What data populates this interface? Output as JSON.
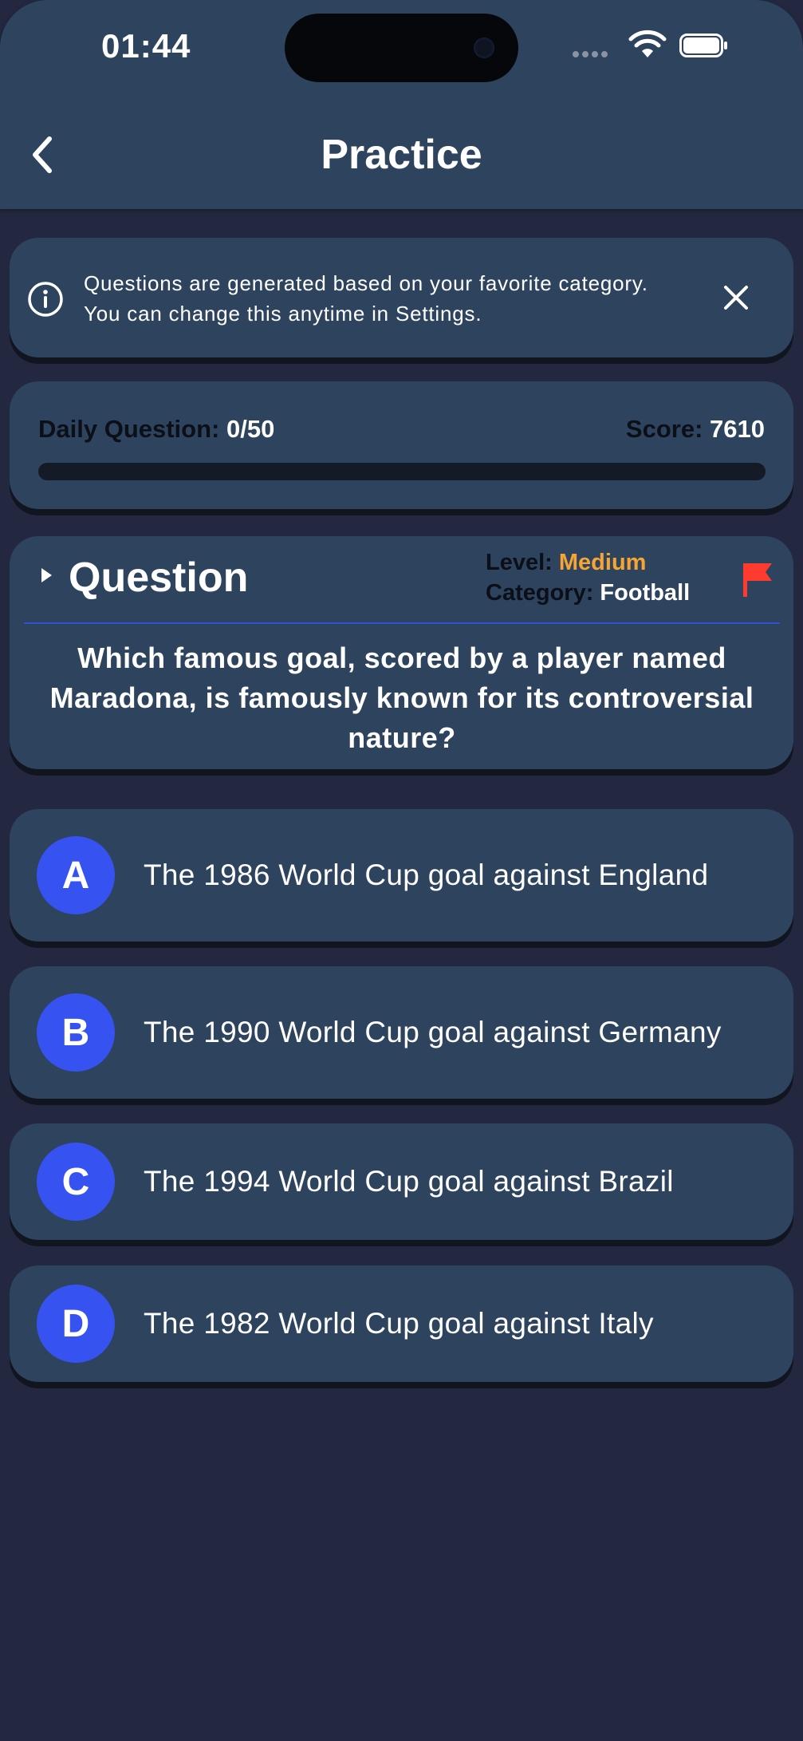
{
  "status_bar": {
    "time": "01:44"
  },
  "header": {
    "title": "Practice",
    "back_icon": "chevron-left-icon"
  },
  "info_banner": {
    "text": "Questions are generated based on your favorite category. You can change this anytime in Settings.",
    "icon": "info-icon",
    "close_icon": "close-icon"
  },
  "progress": {
    "daily_label": "Daily Question:",
    "daily_value": "0/50",
    "score_label": "Score:",
    "score_value": "7610",
    "fraction": 0
  },
  "question": {
    "heading": "Question",
    "level_label": "Level:",
    "level_value": "Medium",
    "category_label": "Category:",
    "category_value": "Football",
    "text": "Which famous goal, scored by a player named Maradona, is famously known for its controversial nature?",
    "flag_icon": "flag-icon"
  },
  "answers": [
    {
      "letter": "A",
      "text": "The 1986 World Cup goal against England"
    },
    {
      "letter": "B",
      "text": "The 1990 World Cup goal against Germany"
    },
    {
      "letter": "C",
      "text": "The 1994 World Cup goal against Brazil"
    },
    {
      "letter": "D",
      "text": "The 1982 World Cup goal against Italy"
    }
  ],
  "colors": {
    "background": "#232840",
    "card": "#2e435e",
    "accent": "#3653f2",
    "level": "#f5a533",
    "flag": "#ff3b30"
  }
}
